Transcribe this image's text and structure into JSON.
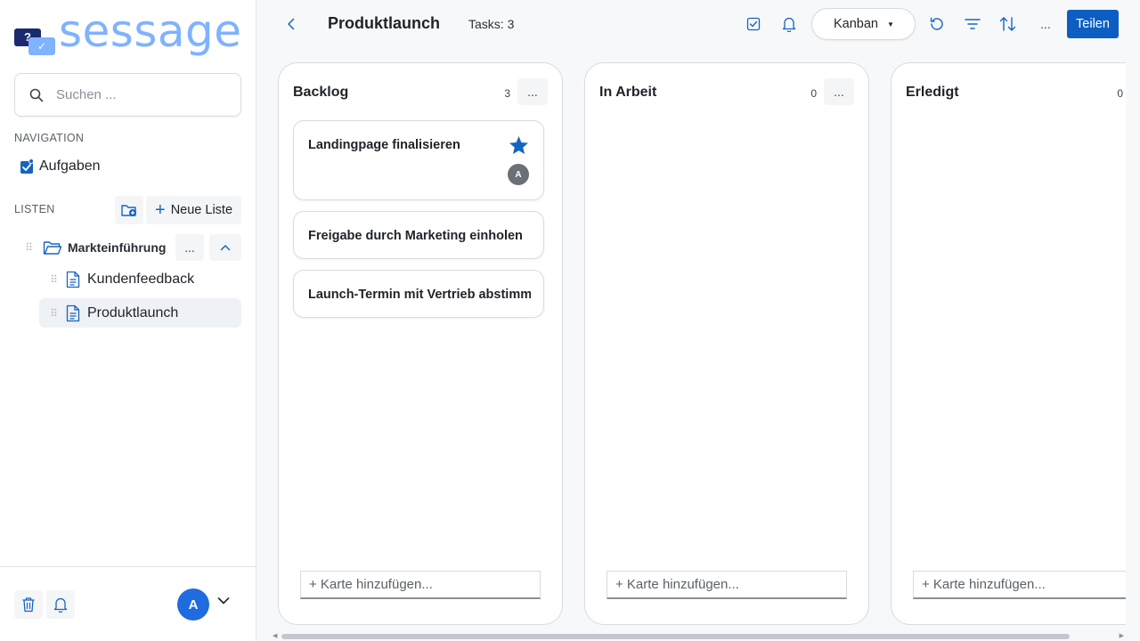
{
  "app": {
    "logo_text": "sessage",
    "logo_badge_left": "?",
    "logo_badge_right": "✓"
  },
  "colors": {
    "accent": "#0d5ec2",
    "logo": "#7fb2ff",
    "logo_dark": "#1c2a6e",
    "avatar": "#1f6be0"
  },
  "sidebar": {
    "search": {
      "placeholder": "Suchen ...",
      "value": "",
      "icon": "search-icon"
    },
    "navigation_label": "NAVIGATION",
    "nav_items": [
      {
        "label": "Aufgaben",
        "icon": "tasks-icon"
      }
    ],
    "lists_label": "LISTEN",
    "new_folder_icon": "add-folder-icon",
    "new_list_label": "Neue Liste",
    "folder": {
      "name": "Markteinführung",
      "more_label": "...",
      "expanded": true,
      "lists": [
        {
          "name": "Kundenfeedback",
          "active": false
        },
        {
          "name": "Produktlaunch",
          "active": true
        }
      ]
    },
    "footer": {
      "trash_icon": "trash-icon",
      "notifications_icon": "bell-icon",
      "avatar_initial": "A"
    }
  },
  "header": {
    "title": "Produktlaunch",
    "task_count": "Tasks: 3",
    "view_select": "Kanban",
    "more_label": "...",
    "share_label": "Teilen"
  },
  "board": {
    "columns": [
      {
        "title": "Backlog",
        "count": "3",
        "more_label": "...",
        "add_card": "+ Karte hinzufügen...",
        "cards": [
          {
            "title": "Landingpage finalisieren",
            "starred": true,
            "assignee": "A"
          },
          {
            "title": "Freigabe durch Marketing einholen",
            "starred": false,
            "assignee": ""
          },
          {
            "title": "Launch-Termin mit Vertrieb abstimmen",
            "starred": false,
            "assignee": ""
          }
        ]
      },
      {
        "title": "In Arbeit",
        "count": "0",
        "more_label": "...",
        "add_card": "+ Karte hinzufügen...",
        "cards": []
      },
      {
        "title": "Erledigt",
        "count": "0",
        "more_label": "...",
        "add_card": "+ Karte hinzufügen...",
        "cards": []
      }
    ]
  }
}
